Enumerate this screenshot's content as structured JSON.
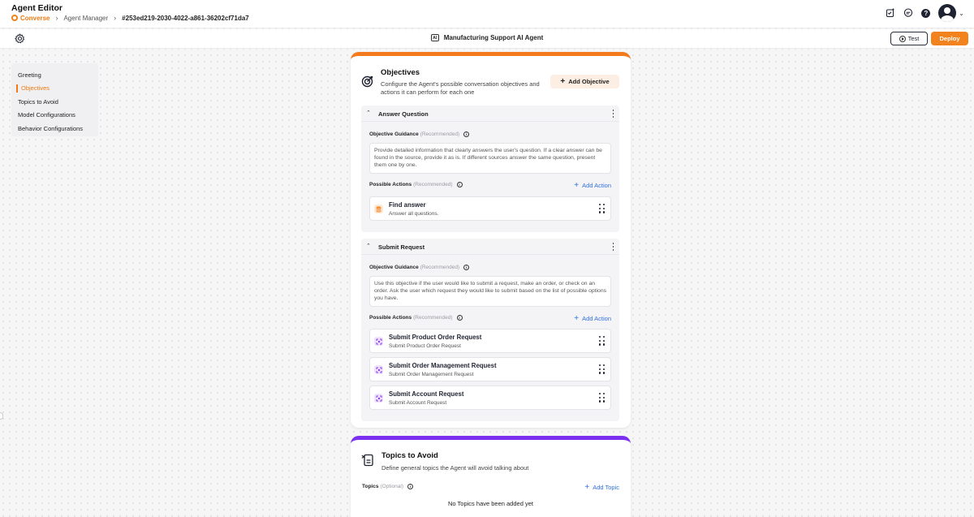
{
  "header": {
    "app_title": "Agent Editor",
    "breadcrumb": {
      "brand": "Converse",
      "section": "Agent Manager",
      "agent_id": "#253ed219-2030-4022-a861-36202cf71da7"
    },
    "icons": [
      "checklist-icon",
      "chat-icon",
      "help-icon",
      "avatar",
      "chevron-down-icon"
    ]
  },
  "toolbar": {
    "agent_badge": "AI",
    "agent_name": "Manufacturing Support AI Agent",
    "test_label": "Test",
    "deploy_label": "Deploy",
    "accent_color": "#f2821e"
  },
  "sidebar": {
    "items": [
      {
        "label": "Greeting",
        "active": false
      },
      {
        "label": "Objectives",
        "active": true
      },
      {
        "label": "Topics to Avoid",
        "active": false
      },
      {
        "label": "Model Configurations",
        "active": false
      },
      {
        "label": "Behavior Configurations",
        "active": false
      }
    ]
  },
  "objectives_card": {
    "title": "Objectives",
    "description": "Configure the Agent's possible conversation objectives and actions it can perform for each one",
    "add_button": "Add Objective",
    "guidance_label": "Objective Guidance",
    "actions_label": "Possible Actions",
    "recommended": "(Recommended)",
    "add_action": "Add Action",
    "objectives": [
      {
        "name": "Answer Question",
        "guidance": "Provide detailed information that clearly answers the user's question. If a clear answer can be found in the source, provide it as is. If different sources answer the same question, present them one by one.",
        "actions": [
          {
            "title": "Find answer",
            "subtitle": "Answer all questions."
          }
        ]
      },
      {
        "name": "Submit Request",
        "guidance": "Use this objective if the user would like to submit a request, make an order, or check on an order. Ask the user which request they would like to submit based on the list of possible options you have.",
        "actions": [
          {
            "title": "Submit Product Order Request",
            "subtitle": "Submit Product Order Request"
          },
          {
            "title": "Submit Order Management Request",
            "subtitle": "Submit Order Management Request"
          },
          {
            "title": "Submit Account Request",
            "subtitle": "Submit Account Request"
          }
        ]
      }
    ]
  },
  "topics_card": {
    "title": "Topics to Avoid",
    "description": "Define general topics the Agent will avoid talking about",
    "topics_label": "Topics",
    "optional": "(Optional)",
    "add_topic": "Add Topic",
    "empty_text": "No Topics have been added yet"
  }
}
